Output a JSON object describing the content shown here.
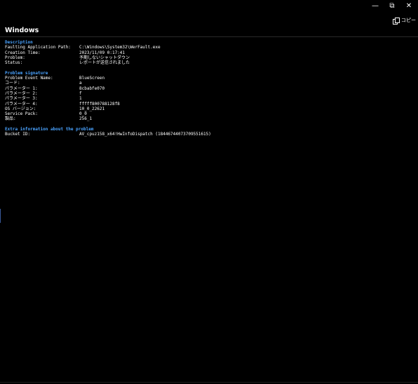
{
  "window_controls": {
    "minimize": "—",
    "restore": "⧉",
    "close": "✕"
  },
  "toolbar": {
    "copy_label": "コピー"
  },
  "title": "Windows",
  "sections": [
    {
      "heading": "Description",
      "rows": [
        {
          "label": "Faulting Application Path:",
          "value": "C:\\Windows\\System32\\WerFault.exe"
        },
        {
          "label": "Creation Time:",
          "value": "2023/11/09 0:17:41"
        },
        {
          "label": "Problem:",
          "value": "予期しないシャットダウン"
        },
        {
          "label": "Status:",
          "value": "レポートが送信されました"
        }
      ]
    },
    {
      "heading": "Problem signature",
      "rows": [
        {
          "label": "Problem Event Name:",
          "value": "BlueScreen"
        },
        {
          "label": "コード:",
          "value": " a"
        },
        {
          "label": "パラメーター 1:",
          "value": " 8cbabfe070"
        },
        {
          "label": "パラメーター 2:",
          "value": " f"
        },
        {
          "label": "パラメーター 3:",
          "value": " 1"
        },
        {
          "label": "パラメーター 4:",
          "value": " fffff800788128f8"
        },
        {
          "label": "OS バージョン:",
          "value": " 10_0_22621"
        },
        {
          "label": "Service Pack:",
          "value": "0_0"
        },
        {
          "label": "製品:",
          "value": " 256_1"
        }
      ]
    },
    {
      "heading": "Extra information about the problem",
      "rows": [
        {
          "label": "Bucket ID:",
          "value": "AV_cpuz158_x64!HwInfoDispatch (18446744073709551615)"
        }
      ]
    }
  ],
  "colors": {
    "background": "#000000",
    "text": "#ffffff",
    "section_heading": "#4aa3ff"
  }
}
